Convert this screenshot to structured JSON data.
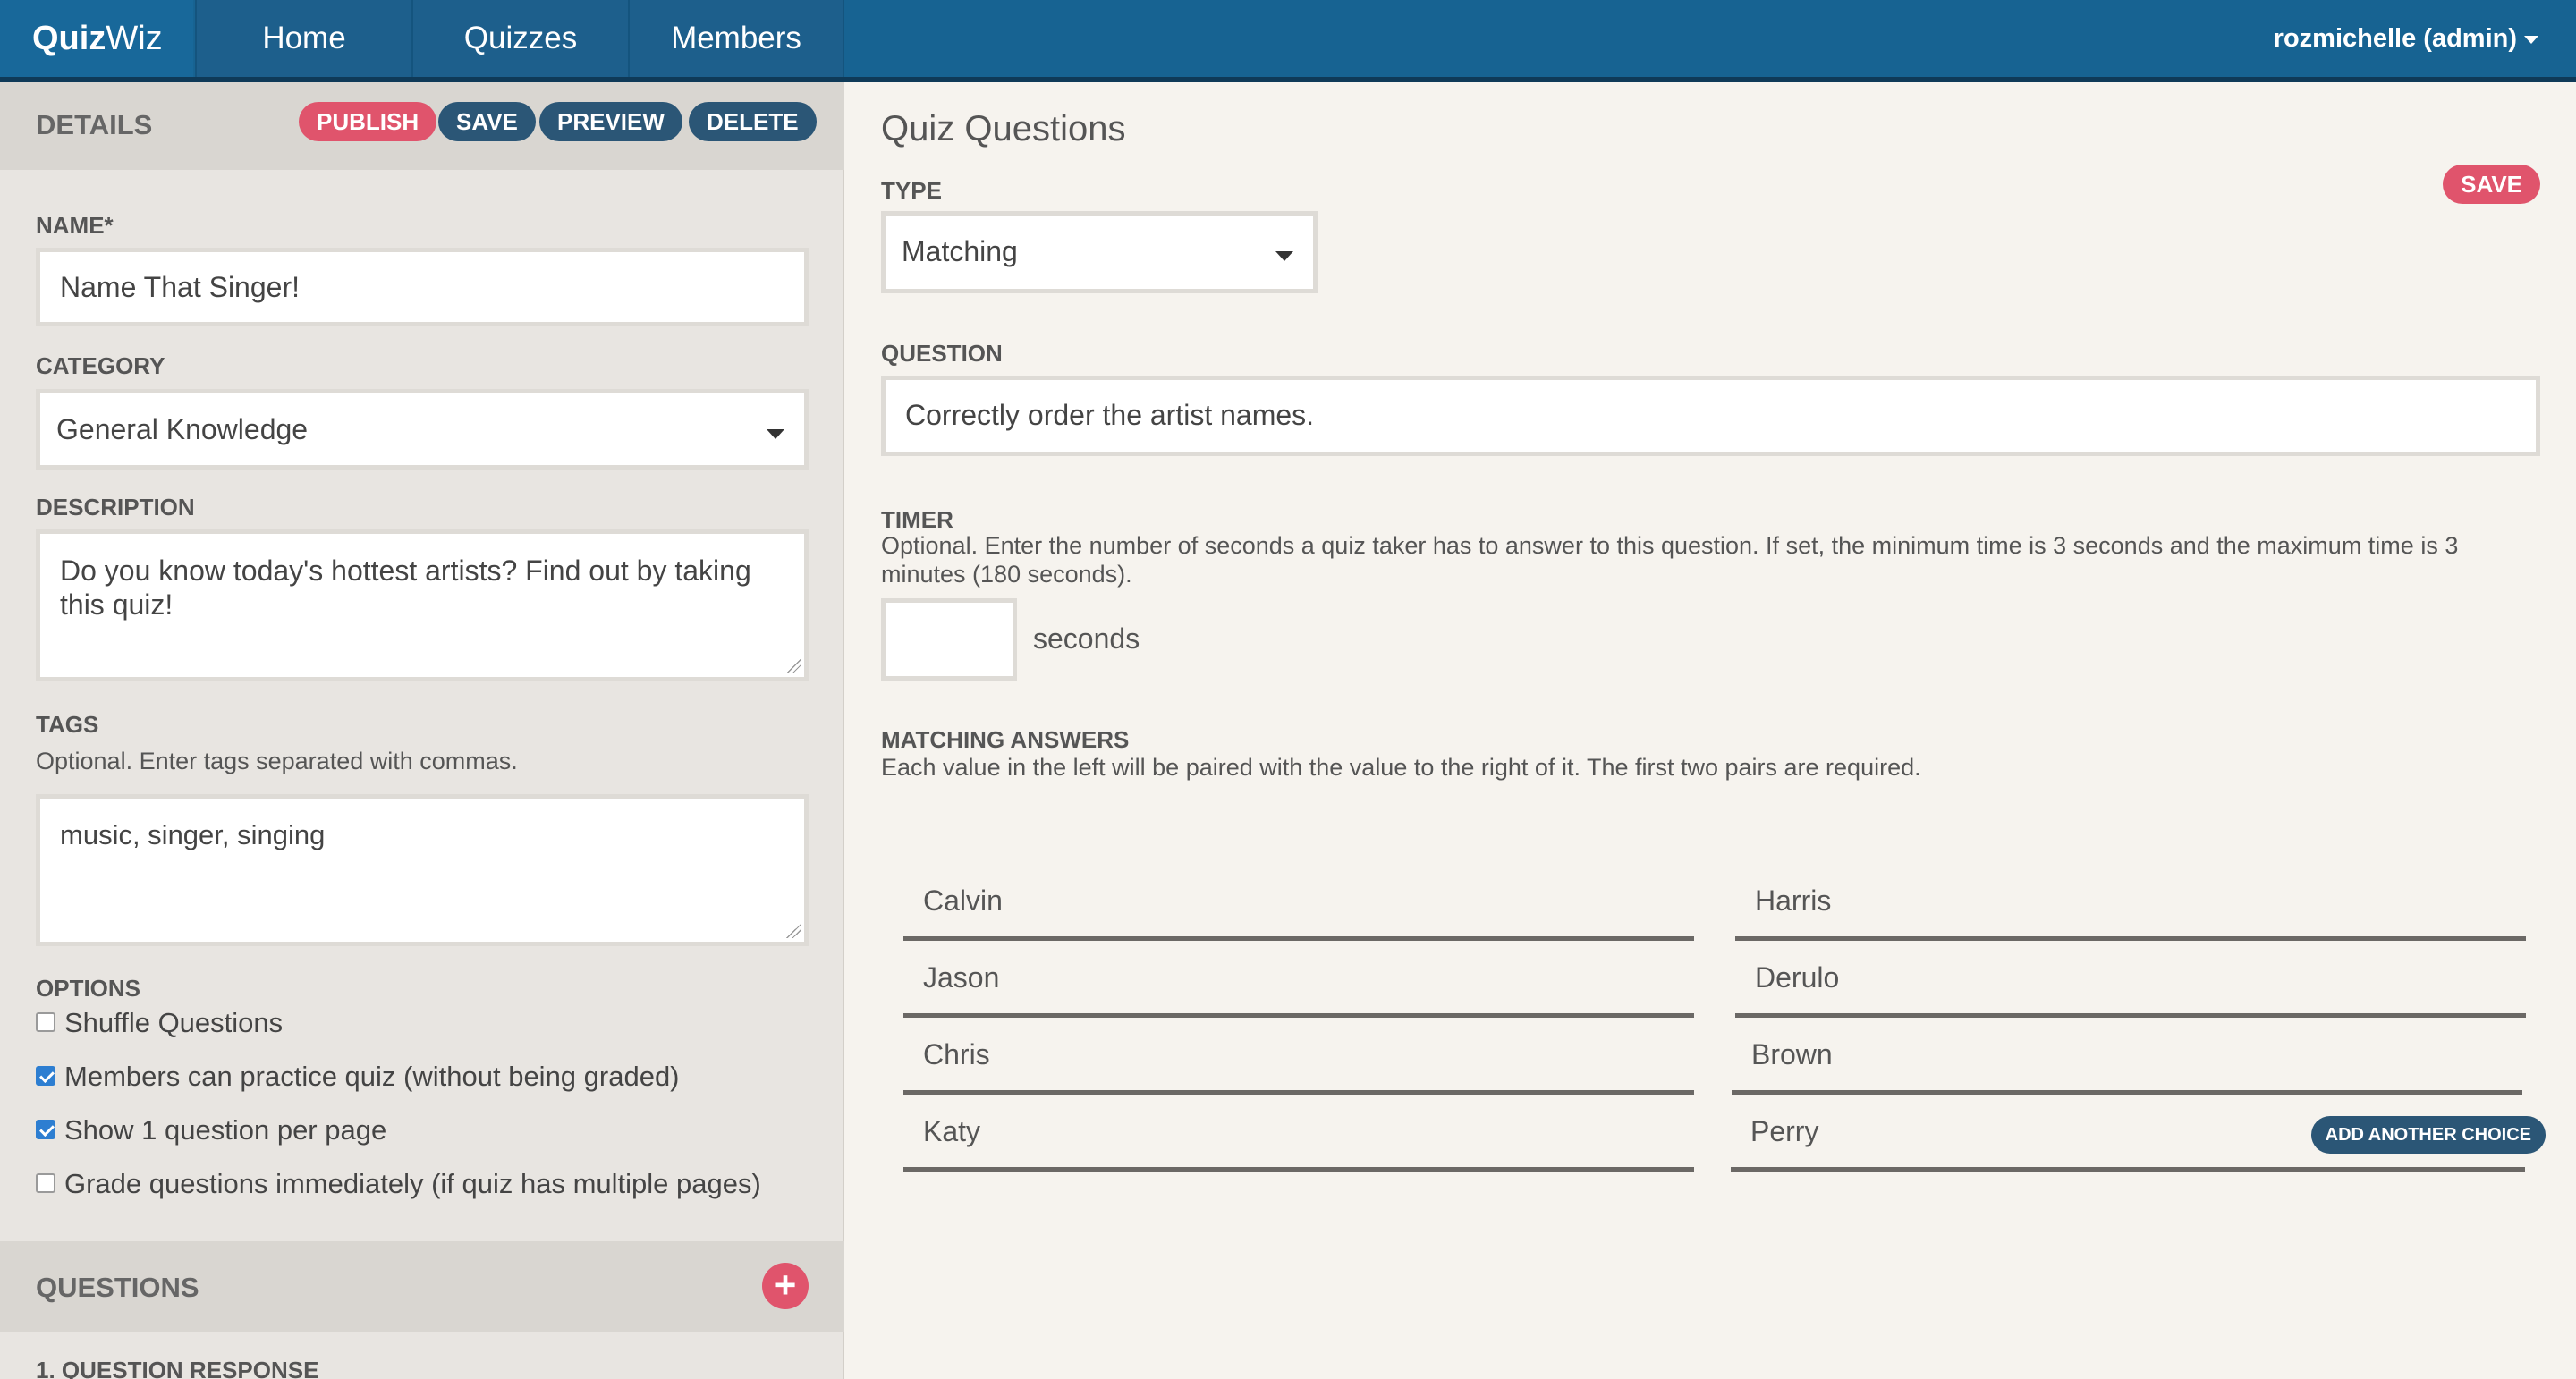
{
  "header": {
    "logo_bold": "Quiz",
    "logo_light": "Wiz",
    "nav": [
      {
        "label": "Home"
      },
      {
        "label": "Quizzes"
      },
      {
        "label": "Members"
      }
    ],
    "user": "rozmichelle (admin)"
  },
  "details": {
    "title": "DETAILS",
    "buttons": {
      "publish": "PUBLISH",
      "save": "SAVE",
      "preview": "PREVIEW",
      "delete": "DELETE"
    },
    "name_label": "NAME*",
    "name_value": "Name That Singer!",
    "category_label": "CATEGORY",
    "category_value": "General Knowledge",
    "description_label": "DESCRIPTION",
    "description_value": "Do you know today's hottest artists? Find out by taking this quiz!",
    "tags_label": "TAGS",
    "tags_help": "Optional. Enter tags separated with commas.",
    "tags_value": "music, singer, singing",
    "options_label": "OPTIONS",
    "options": [
      {
        "label": "Shuffle Questions",
        "checked": false
      },
      {
        "label": "Members can practice quiz (without being graded)",
        "checked": true
      },
      {
        "label": "Show 1 question per page",
        "checked": true
      },
      {
        "label": "Grade questions immediately (if quiz has multiple pages)",
        "checked": false
      }
    ]
  },
  "questions": {
    "title": "QUESTIONS",
    "add_symbol": "+",
    "first_item": "1. QUESTION RESPONSE"
  },
  "editor": {
    "title": "Quiz Questions",
    "save": "SAVE",
    "type_label": "TYPE",
    "type_value": "Matching",
    "question_label": "QUESTION",
    "question_value": "Correctly order the artist names.",
    "timer_label": "TIMER",
    "timer_help": "Optional. Enter the number of seconds a quiz taker has to answer to this question. If set, the minimum time is 3 seconds and the maximum time is 3 minutes (180 seconds).",
    "timer_value": "",
    "seconds": "seconds",
    "matching_label": "MATCHING ANSWERS",
    "matching_help": "Each value in the left will be paired with the value to the right of it. The first two pairs are required.",
    "pairs": [
      {
        "left": "Calvin",
        "right": "Harris"
      },
      {
        "left": "Jason",
        "right": "Derulo"
      },
      {
        "left": "Chris",
        "right": "Brown"
      },
      {
        "left": "Katy",
        "right": "Perry"
      }
    ],
    "add_choice": "ADD ANOTHER CHOICE"
  },
  "colors": {
    "header": "#176392",
    "accent_red": "#e0546c",
    "button_blue": "#2b5676",
    "checkbox_blue": "#2d7ed1"
  }
}
